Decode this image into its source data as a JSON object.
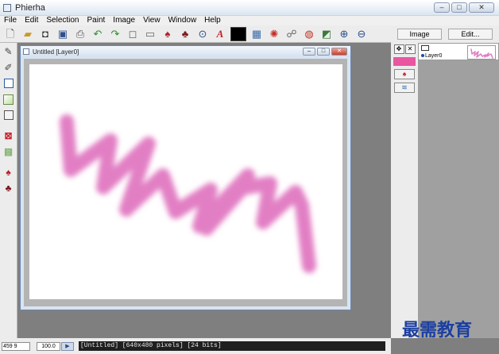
{
  "app": {
    "title": "Phierha"
  },
  "window_controls": {
    "minimize": "–",
    "maximize": "□",
    "close": "✕"
  },
  "menu": [
    "File",
    "Edit",
    "Selection",
    "Paint",
    "Image",
    "View",
    "Window",
    "Help"
  ],
  "toolbar_icons": [
    "new-doc-icon",
    "open-folder-icon",
    "camera-icon",
    "save-icon",
    "print-icon",
    "undo-icon",
    "redo-icon",
    "cut-icon",
    "paste-icon",
    "brush-icon",
    "smudge-icon",
    "zoom-icon",
    "text-icon",
    "color-swatch",
    "image-icon",
    "filter-icon",
    "clipboard-icon",
    "globe-icon",
    "adjust-icon",
    "zoom-in-icon",
    "zoom-out-icon"
  ],
  "document": {
    "title": "Untitled [Layer0]",
    "stroke_color": "#e27fc4"
  },
  "right_panel": {
    "tab_image": "Image",
    "tab_edit": "Edit...",
    "layer_name": "Layer0",
    "foreground_color": "#e8579f"
  },
  "status": {
    "coords": "459 9",
    "zoom": "100.0",
    "info": "[Untitled] [640x480 pixels] [24 bits]"
  },
  "watermark": "最需教育"
}
